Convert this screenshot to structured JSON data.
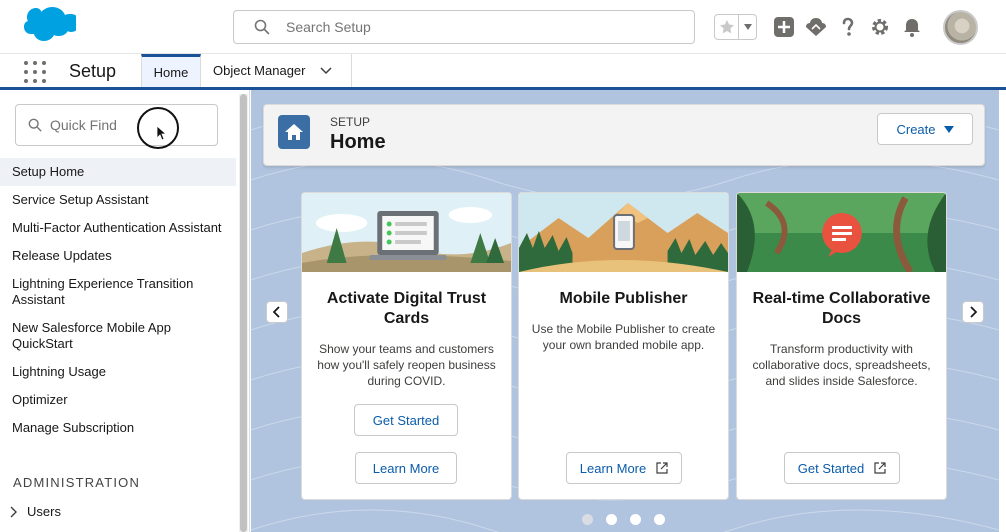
{
  "header": {
    "search_placeholder": "Search Setup",
    "icons": [
      "favorites-star-icon",
      "add-icon",
      "trailhead-icon",
      "help-icon",
      "gear-icon",
      "notifications-bell-icon"
    ]
  },
  "nav": {
    "app_name": "Setup",
    "tabs": [
      {
        "label": "Home",
        "active": true
      },
      {
        "label": "Object Manager",
        "active": false
      }
    ]
  },
  "sidebar": {
    "quickfind_placeholder": "Quick Find",
    "items": [
      {
        "label": "Setup Home",
        "active": true
      },
      {
        "label": "Service Setup Assistant"
      },
      {
        "label": "Multi-Factor Authentication Assistant"
      },
      {
        "label": "Release Updates"
      },
      {
        "label": "Lightning Experience Transition Assistant"
      },
      {
        "label": "New Salesforce Mobile App QuickStart"
      },
      {
        "label": "Lightning Usage"
      },
      {
        "label": "Optimizer"
      },
      {
        "label": "Manage Subscription"
      }
    ],
    "section_title": "ADMINISTRATION",
    "tree_items": [
      {
        "label": "Users"
      }
    ]
  },
  "page_header": {
    "eyebrow": "SETUP",
    "title": "Home",
    "create_label": "Create"
  },
  "cards": [
    {
      "title": "Activate Digital Trust Cards",
      "description": "Show your teams and customers how you'll safely reopen business during COVID.",
      "buttons": [
        "Get Started",
        "Learn More"
      ]
    },
    {
      "title": "Mobile Publisher",
      "description": "Use the Mobile Publisher to create your own branded mobile app.",
      "buttons": [
        "Learn More"
      ]
    },
    {
      "title": "Real-time Collaborative Docs",
      "description": "Transform productivity with collaborative docs, spreadsheets, and slides inside Salesforce.",
      "buttons": [
        "Get Started"
      ]
    }
  ],
  "carousel": {
    "active_index": 0,
    "count": 4
  },
  "colors": {
    "brand_blue": "#1b5297",
    "link_blue": "#0b5cab",
    "cloud_blue": "#00a1e0"
  }
}
